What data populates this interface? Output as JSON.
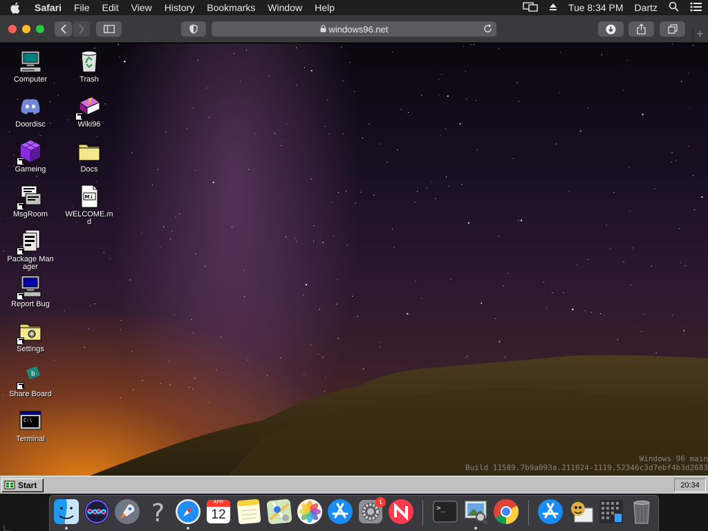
{
  "menubar": {
    "app_name": "Safari",
    "menus": [
      "File",
      "Edit",
      "View",
      "History",
      "Bookmarks",
      "Window",
      "Help"
    ],
    "clock": "Tue 8:34 PM",
    "user": "Dartz",
    "icons": [
      "apple-icon",
      "airplay-display-icon",
      "eject-icon",
      "spotlight-search-icon",
      "notification-center-icon"
    ]
  },
  "browser": {
    "url": "windows96.net",
    "new_tab_glyph": "+"
  },
  "desktop": {
    "icons": [
      {
        "label": "Computer",
        "icon": "computer-icon"
      },
      {
        "label": "Trash",
        "icon": "recycle-bin-icon"
      },
      {
        "label": "Doordisc",
        "icon": "discord-icon"
      },
      {
        "label": "Wiki96",
        "icon": "help-book-icon"
      },
      {
        "label": "Gameing",
        "icon": "game-cube-icon"
      },
      {
        "label": "Docs",
        "icon": "folder-icon"
      },
      {
        "label": "MsgRoom",
        "icon": "msgroom-icon"
      },
      {
        "label": "WELCOME.md",
        "icon": "markdown-file-icon"
      },
      {
        "label": "Package Manager",
        "icon": "package-manager-icon"
      },
      {
        "label": "Report Bug",
        "icon": "bug-report-icon"
      },
      {
        "label": "Settings",
        "icon": "settings-folder-icon"
      },
      {
        "label": "Share Board",
        "icon": "share-board-icon"
      },
      {
        "label": "Terminal",
        "icon": "terminal-icon"
      }
    ],
    "build_line1": "Windows 96 main",
    "build_line2": "Build 11589.7b9a093a.211024-1119.52346c3d7ebf4b3d2683"
  },
  "taskbar": {
    "start_label": "Start",
    "clock": "20:34"
  },
  "dock": {
    "calendar_month": "APR",
    "calendar_day": "12",
    "settings_badge": "1",
    "terminal_prompt": ">_",
    "items": [
      "finder-icon",
      "siri-icon",
      "launchpad-icon",
      "help-icon",
      "safari-icon",
      "calendar-icon",
      "notes-icon",
      "maps-icon",
      "photos-icon",
      "app-store-icon",
      "system-preferences-icon",
      "news-icon",
      "terminal-icon",
      "preview-icon",
      "chrome-icon",
      "app-store-download-icon",
      "character-app-icon",
      "grid-app-icon",
      "trash-icon"
    ],
    "colors": {
      "accent": "#147efb",
      "badge": "#ff3b30"
    }
  }
}
